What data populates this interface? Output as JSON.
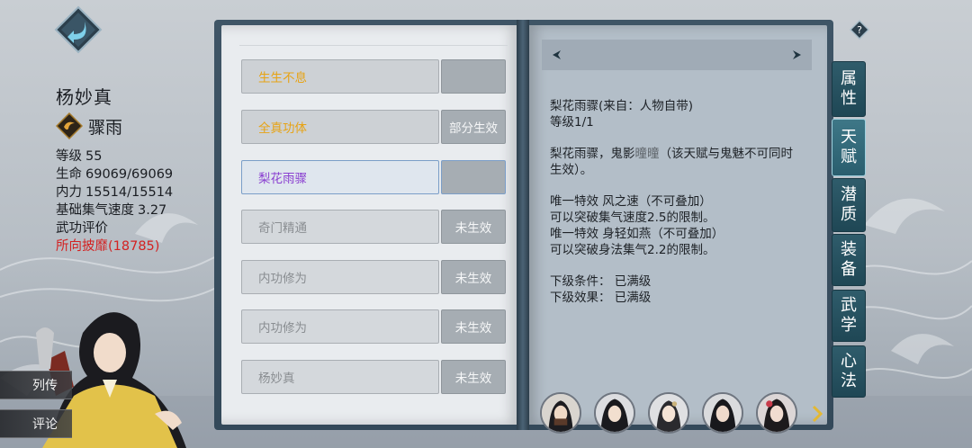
{
  "character": {
    "name": "杨妙真",
    "school": "骤雨",
    "stats": {
      "level_label": "等级",
      "level_value": "55",
      "hp_label": "生命",
      "hp_value": "69069/69069",
      "mp_label": "内力",
      "mp_value": "15514/15514",
      "qi_speed_label": "基础集气速度",
      "qi_speed_value": "3.27",
      "rating_label": "武功评价",
      "rating_value": "所向披靡(18785)"
    }
  },
  "left_tabs": {
    "biography": "列传",
    "comment": "评论"
  },
  "talents": [
    {
      "name": "生生不息",
      "status": ""
    },
    {
      "name": "全真功体",
      "status": "部分生效"
    },
    {
      "name": "梨花雨骤",
      "status": ""
    },
    {
      "name": "奇门精通",
      "status": "未生效"
    },
    {
      "name": "内功修为",
      "status": "未生效"
    },
    {
      "name": "内功修为",
      "status": "未生效"
    },
    {
      "name": "杨妙真",
      "status": "未生效"
    }
  ],
  "detail": {
    "line1": "梨花雨骤(来自：人物自带)",
    "line2": "等级1/1",
    "line3a": "梨花雨骤，鬼影",
    "line3b": "曈曈",
    "line3c": "（该天赋与鬼魅不可同时",
    "line4": "生效）。",
    "line5": "唯一特效 风之速（不可叠加）",
    "line6": "可以突破集气速度2.5的限制。",
    "line7": "唯一特效 身轻如燕（不可叠加）",
    "line8": "可以突破身法集气2.2的限制。",
    "line9": "下级条件：  已满级",
    "line10": "下级效果：  已满级"
  },
  "side_tabs": [
    {
      "chars": [
        "属",
        "性"
      ]
    },
    {
      "chars": [
        "天",
        "赋"
      ]
    },
    {
      "chars": [
        "潜",
        "质"
      ]
    },
    {
      "chars": [
        "装",
        "备"
      ]
    },
    {
      "chars": [
        "武",
        "学"
      ]
    },
    {
      "chars": [
        "心",
        "法"
      ]
    }
  ],
  "help_symbol": "?",
  "colors": {
    "active_talent": "#e7a314",
    "selected_talent": "#8a3fd0",
    "rating_red": "#d32222",
    "tab_teal": "#1f4755"
  },
  "icons": [
    "back-arrow-icon",
    "school-icon",
    "arrow-left-icon",
    "arrow-right-icon",
    "help-icon",
    "next-chevron-icon"
  ]
}
